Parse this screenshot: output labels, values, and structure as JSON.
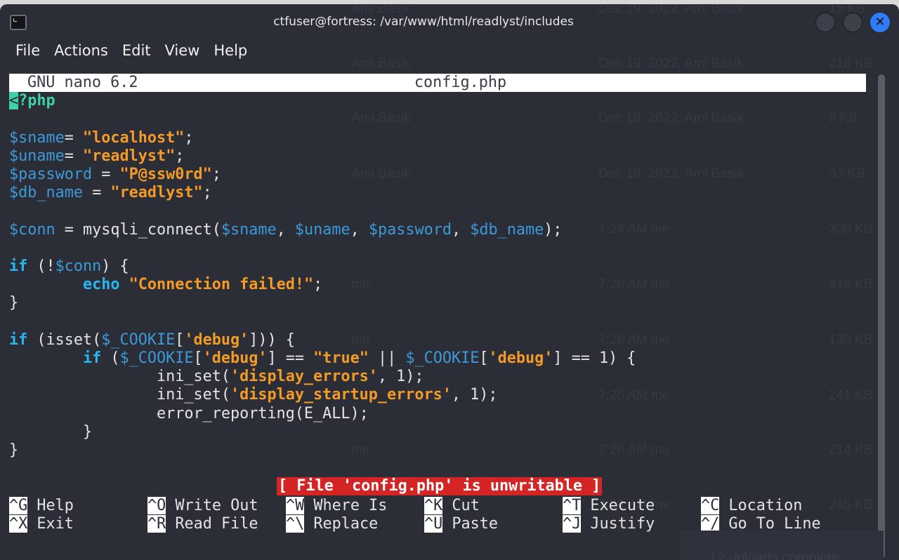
{
  "window": {
    "title": "ctfuser@fortress: /var/www/html/readlyst/includes",
    "close_glyph": "✕"
  },
  "menu": [
    "File",
    "Actions",
    "Edit",
    "View",
    "Help"
  ],
  "nano": {
    "version_label": "GNU nano 6.2",
    "filename": "config.php",
    "status": "[ File 'config.php' is unwritable ]"
  },
  "code": [
    [
      [
        "<",
        "cur"
      ],
      [
        "?php",
        "tag"
      ]
    ],
    [],
    [
      [
        "$sname",
        "v"
      ],
      [
        "= ",
        ""
      ],
      [
        "\"localhost\"",
        "s"
      ],
      [
        ";",
        ""
      ]
    ],
    [
      [
        "$uname",
        "v"
      ],
      [
        "= ",
        ""
      ],
      [
        "\"readlyst\"",
        "s"
      ],
      [
        ";",
        ""
      ]
    ],
    [
      [
        "$password",
        "v"
      ],
      [
        " = ",
        ""
      ],
      [
        "\"P@ssw0rd\"",
        "s"
      ],
      [
        ";",
        ""
      ]
    ],
    [
      [
        "$db_name",
        "v"
      ],
      [
        " = ",
        ""
      ],
      [
        "\"readlyst\"",
        "s"
      ],
      [
        ";",
        ""
      ]
    ],
    [],
    [
      [
        "$conn",
        "v"
      ],
      [
        " = mysqli_connect(",
        ""
      ],
      [
        "$sname",
        "v"
      ],
      [
        ", ",
        ""
      ],
      [
        "$uname",
        "v"
      ],
      [
        ", ",
        ""
      ],
      [
        "$password",
        "v"
      ],
      [
        ", ",
        ""
      ],
      [
        "$db_name",
        "v"
      ],
      [
        ");",
        ""
      ]
    ],
    [],
    [
      [
        "if",
        "k"
      ],
      [
        " (!",
        ""
      ],
      [
        "$conn",
        "v"
      ],
      [
        ") {",
        ""
      ]
    ],
    [
      [
        "        ",
        ""
      ],
      [
        "echo",
        "k"
      ],
      [
        " ",
        ""
      ],
      [
        "\"Connection failed!\"",
        "s"
      ],
      [
        ";",
        ""
      ]
    ],
    [
      [
        "}",
        ""
      ]
    ],
    [],
    [
      [
        "if",
        "k"
      ],
      [
        " (isset(",
        ""
      ],
      [
        "$_COOKIE",
        "v"
      ],
      [
        "[",
        ""
      ],
      [
        "'debug'",
        "s"
      ],
      [
        "])) {",
        ""
      ]
    ],
    [
      [
        "        ",
        ""
      ],
      [
        "if",
        "k"
      ],
      [
        " (",
        ""
      ],
      [
        "$_COOKIE",
        "v"
      ],
      [
        "[",
        ""
      ],
      [
        "'debug'",
        "s"
      ],
      [
        "] == ",
        ""
      ],
      [
        "\"true\"",
        "s"
      ],
      [
        " || ",
        ""
      ],
      [
        "$_COOKIE",
        "v"
      ],
      [
        "[",
        ""
      ],
      [
        "'debug'",
        "s"
      ],
      [
        "] == 1) {",
        ""
      ]
    ],
    [
      [
        "                ini_set(",
        ""
      ],
      [
        "'display_errors'",
        "s"
      ],
      [
        ", 1);",
        ""
      ]
    ],
    [
      [
        "                ini_set(",
        ""
      ],
      [
        "'display_startup_errors'",
        "s"
      ],
      [
        ", 1);",
        ""
      ]
    ],
    [
      [
        "                error_reporting(E_ALL);",
        ""
      ]
    ],
    [
      [
        "        }",
        ""
      ]
    ],
    [
      [
        "}",
        ""
      ]
    ]
  ],
  "shortcuts": [
    [
      {
        "key": "^G",
        "label": "Help"
      },
      {
        "key": "^O",
        "label": "Write Out"
      },
      {
        "key": "^W",
        "label": "Where Is"
      },
      {
        "key": "^K",
        "label": "Cut"
      },
      {
        "key": "^T",
        "label": "Execute"
      },
      {
        "key": "^C",
        "label": "Location"
      }
    ],
    [
      {
        "key": "^X",
        "label": "Exit"
      },
      {
        "key": "^R",
        "label": "Read File"
      },
      {
        "key": "^\\",
        "label": "Replace"
      },
      {
        "key": "^U",
        "label": "Paste"
      },
      {
        "key": "^J",
        "label": "Justify"
      },
      {
        "key": "^/",
        "label": "Go To Line"
      }
    ]
  ],
  "background_window": {
    "rows": [
      [
        "Ami Basik",
        "Dec 19, 2022, Ami Basik",
        "15 KB"
      ],
      [
        "Ami Basik",
        "Dec 19, 2022, Ami Basik",
        "216 KB"
      ],
      [
        "Ami Basik",
        "Dec 19, 2022, Ami Basik",
        "9 KB"
      ],
      [
        "Ami Basik",
        "Dec 19, 2022, Ami Basik",
        "33 KB"
      ],
      [
        "",
        "7:24 AM me",
        "330 KB"
      ],
      [
        "me",
        "7:26 AM me",
        "419 KB"
      ],
      [
        "me",
        "7:26 AM me",
        "130 KB"
      ],
      [
        "",
        "7:26 AM me",
        "241 KB"
      ],
      [
        "me",
        "7:26 AM me",
        "214 KB"
      ],
      [
        "",
        "7:26 AM me",
        "245 KB"
      ]
    ],
    "toast": "12 uploads complete"
  },
  "colors": {
    "background": "#2b2d37",
    "variable": "#3c9ad8",
    "string": "#f39b26",
    "keyword": "#27b6ee",
    "status_bg": "#d42424",
    "close_button": "#2f7cf6"
  }
}
